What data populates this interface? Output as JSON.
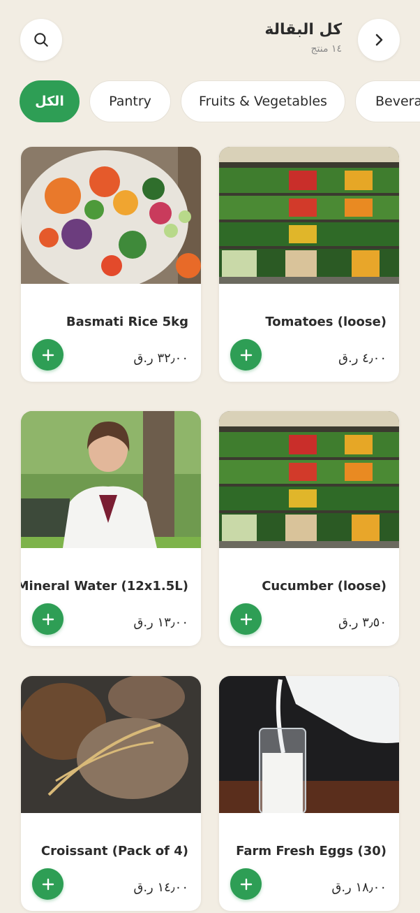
{
  "header": {
    "title": "كل البقالة",
    "subtitle": "١٤ منتج",
    "search_icon": "search-icon",
    "back_icon": "chevron-right-icon"
  },
  "categories": [
    {
      "label": "الكل",
      "active": true
    },
    {
      "label": "Pantry",
      "active": false
    },
    {
      "label": "Fruits & Vegetables",
      "active": false
    },
    {
      "label": "Beverages",
      "active": false
    }
  ],
  "products": [
    {
      "name": "Basmati Rice 5kg",
      "price": "٣٢٫٠٠ ر.ق",
      "image": "salad-bowl"
    },
    {
      "name": "Tomatoes (loose)",
      "price": "٤٫٠٠ ر.ق",
      "image": "produce-shelves"
    },
    {
      "name": "Mineral Water (12x1.5L)",
      "price": "١٣٫٠٠ ر.ق",
      "image": "woman-portrait"
    },
    {
      "name": "Cucumber (loose)",
      "price": "٣٫٥٠ ر.ق",
      "image": "produce-shelves"
    },
    {
      "name": "Croissant (Pack of 4)",
      "price": "١٤٫٠٠ ر.ق",
      "image": "bread-loaves"
    },
    {
      "name": "Farm Fresh Eggs (30)",
      "price": "١٨٫٠٠ ر.ق",
      "image": "milk-pour"
    }
  ],
  "colors": {
    "background": "#f2ede3",
    "accent": "#2e9e55",
    "card": "#ffffff",
    "text": "#2b2b2b",
    "muted": "#8a8a8a"
  }
}
